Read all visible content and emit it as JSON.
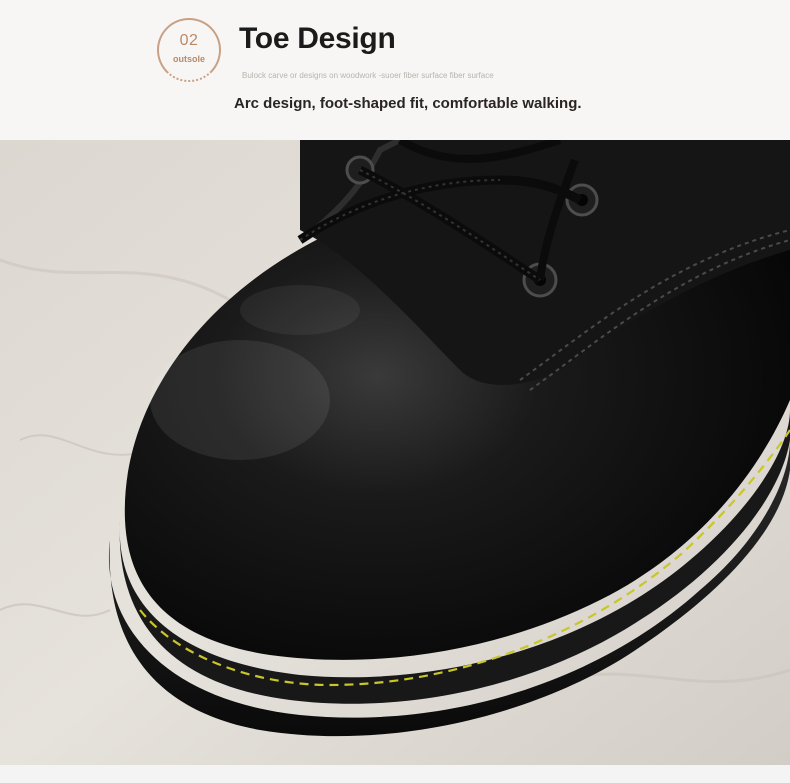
{
  "badge": {
    "number": "02",
    "label": "outsole"
  },
  "heading": {
    "title": "Toe Design",
    "subtitle": "Bulock carve or designs on woodwork -suoer fiber surface   fiber surface",
    "tagline": "Arc design, foot-shaped fit, comfortable walking."
  },
  "colors": {
    "accent": "#c9a083",
    "title": "#1b1b1b",
    "leather": "#0d0d0d",
    "stitch": "#c8c62a"
  }
}
